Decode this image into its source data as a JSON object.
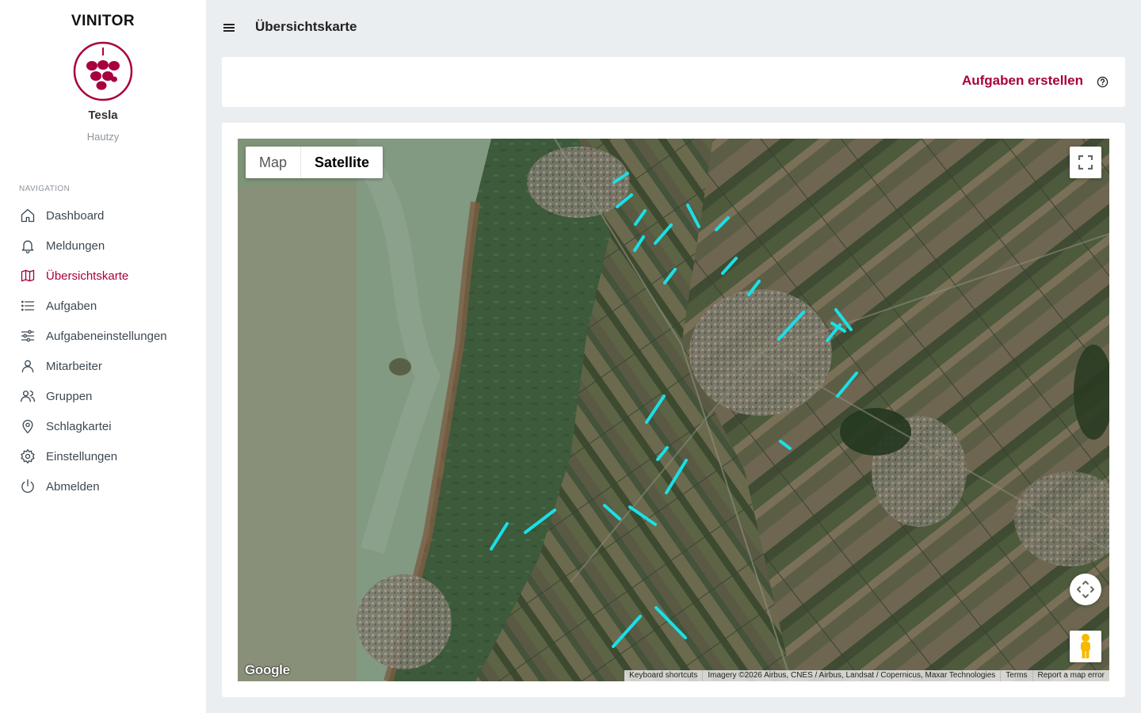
{
  "app": {
    "brand": "VINITOR",
    "user_name": "Tesla",
    "user_subtitle": "Hautzy",
    "accent_color": "#a8003e"
  },
  "sidebar": {
    "heading": "NAVIGATION",
    "items": [
      {
        "label": "Dashboard",
        "icon": "home-icon"
      },
      {
        "label": "Meldungen",
        "icon": "bell-icon"
      },
      {
        "label": "Übersichtskarte",
        "icon": "map-icon",
        "active": true
      },
      {
        "label": "Aufgaben",
        "icon": "list-icon"
      },
      {
        "label": "Aufgabeneinstellungen",
        "icon": "sliders-icon"
      },
      {
        "label": "Mitarbeiter",
        "icon": "user-icon"
      },
      {
        "label": "Gruppen",
        "icon": "users-icon"
      },
      {
        "label": "Schlagkartei",
        "icon": "map-pin-icon"
      },
      {
        "label": "Einstellungen",
        "icon": "gear-icon"
      },
      {
        "label": "Abmelden",
        "icon": "power-icon"
      }
    ]
  },
  "header": {
    "title": "Übersichtskarte"
  },
  "actions": {
    "create_tasks_label": "Aufgaben erstellen"
  },
  "map": {
    "type_options": [
      "Map",
      "Satellite"
    ],
    "selected_type": "Satellite",
    "google_logo": "Google",
    "attribution": {
      "shortcuts": "Keyboard shortcuts",
      "imagery": "Imagery ©2026 Airbus, CNES / Airbus, Landsat / Copernicus, Maxar Technologies",
      "terms": "Terms",
      "report": "Report a map error"
    },
    "highlight_color": "#19e0e8"
  }
}
